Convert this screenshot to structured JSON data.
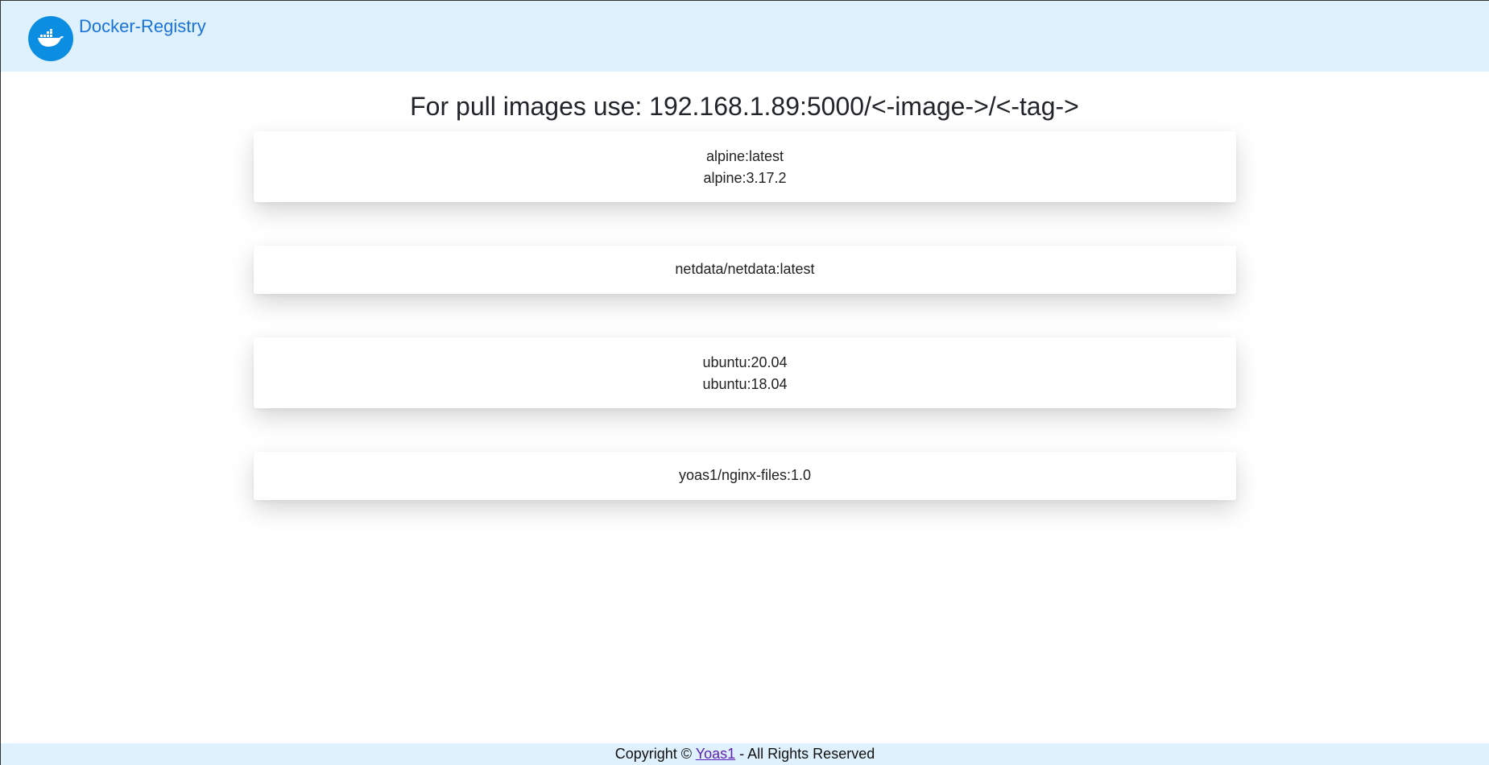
{
  "header": {
    "brand": "Docker-Registry",
    "logo_icon": "docker-whale-icon",
    "background_color": "#dff1fc",
    "logo_color": "#0b8de2",
    "brand_color": "#1a73d9"
  },
  "main": {
    "heading": "For pull images use: 192.168.1.89:5000/<-image->/<-tag->",
    "repositories": [
      {
        "tags": [
          "alpine:latest",
          "alpine:3.17.2"
        ]
      },
      {
        "tags": [
          "netdata/netdata:latest"
        ]
      },
      {
        "tags": [
          "ubuntu:20.04",
          "ubuntu:18.04"
        ]
      },
      {
        "tags": [
          "yoas1/nginx-files:1.0"
        ]
      }
    ]
  },
  "footer": {
    "prefix": "Copyright ©",
    "link": "Yoas1",
    "suffix": "- All Rights Reserved"
  }
}
